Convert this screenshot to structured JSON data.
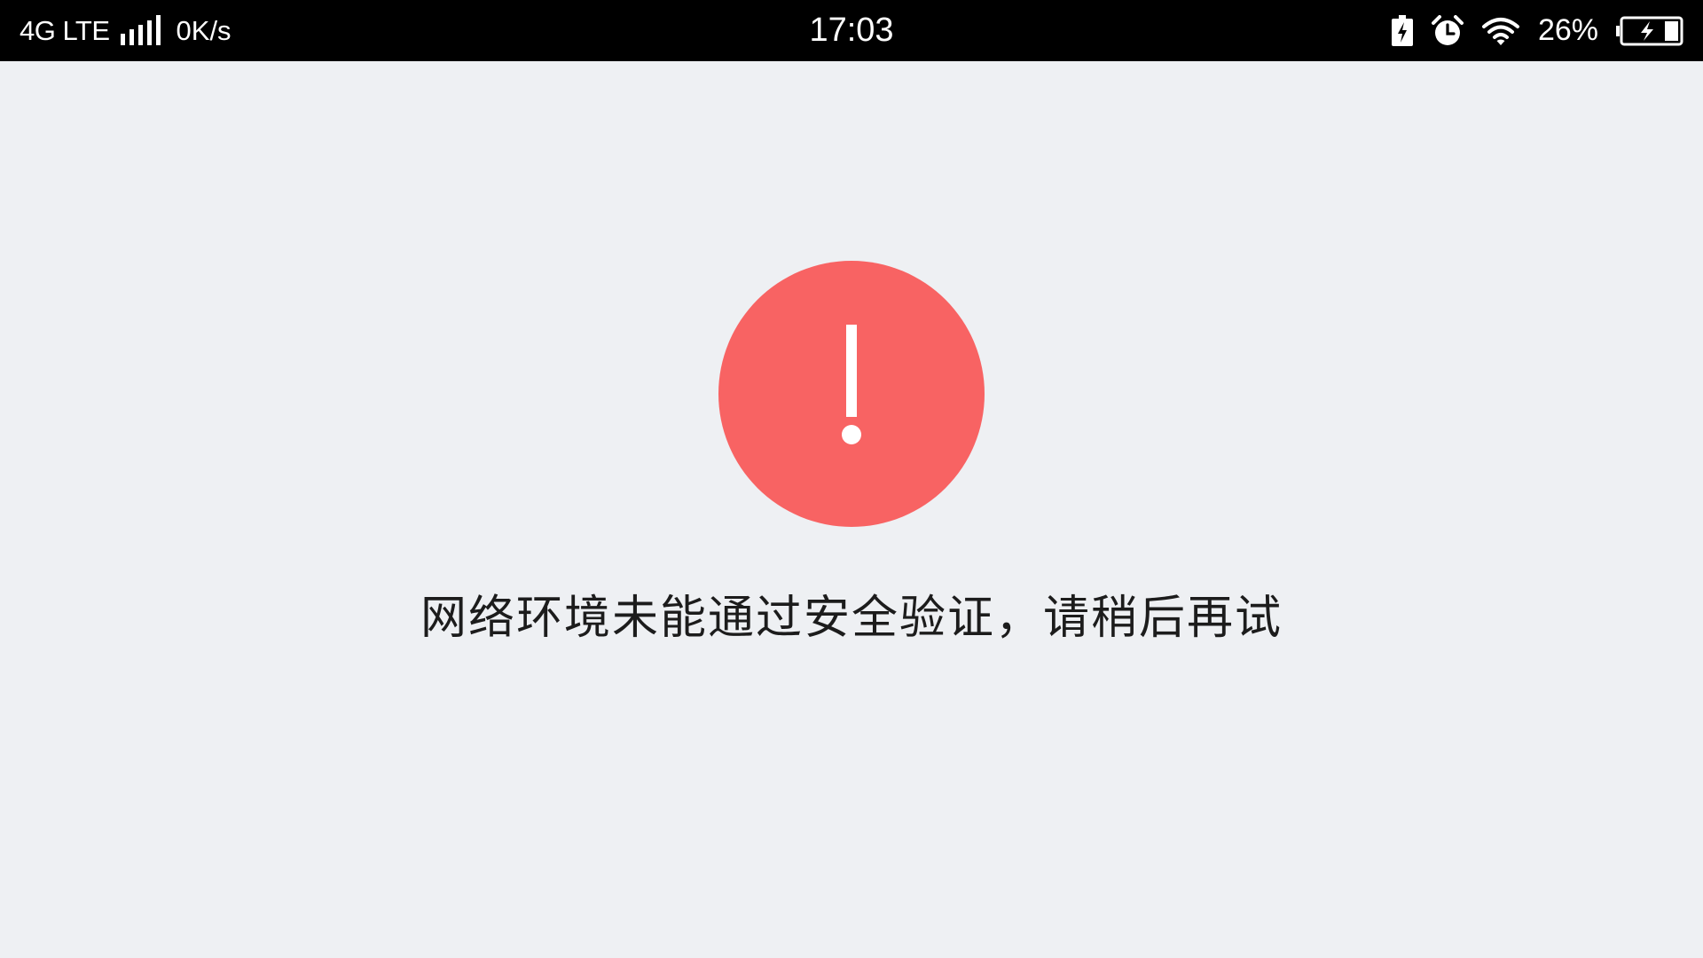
{
  "status_bar": {
    "network": "4G LTE",
    "signal_strength": 5,
    "speed": "0K/s",
    "time": "17:03",
    "icons": [
      "battery-saver-icon",
      "alarm-icon",
      "wifi-icon",
      "battery-charging-icon"
    ],
    "battery_percent": "26%"
  },
  "error": {
    "icon": "exclamation-icon",
    "color": "#F86363",
    "message": "网络环境未能通过安全验证，请稍后再试"
  }
}
